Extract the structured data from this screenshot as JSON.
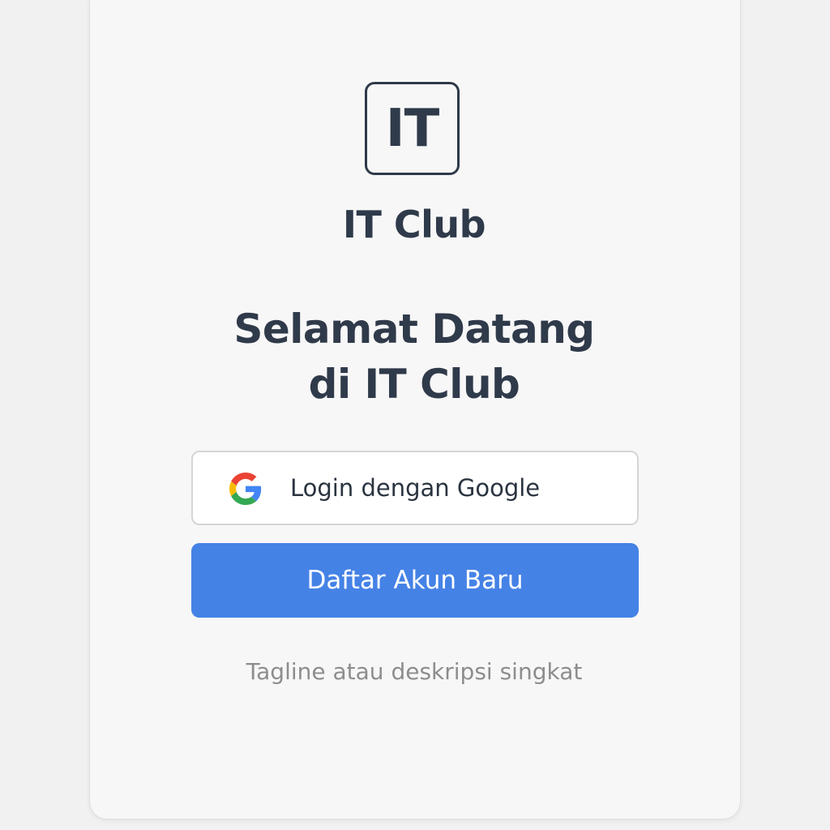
{
  "logo": {
    "text": "IT"
  },
  "app_name": "IT Club",
  "welcome": {
    "line1": "Selamat Datang",
    "line2": "di IT Club"
  },
  "buttons": {
    "google_login": {
      "label": "Login dengan Google",
      "icon": "google-icon"
    },
    "register": {
      "label": "Daftar Akun Baru"
    }
  },
  "tagline": "Tagline atau deskripsi singkat",
  "colors": {
    "primary": "#4582e6",
    "text_dark": "#2f3a4a",
    "muted": "#8d8d8d",
    "background": "#f1f1f1",
    "card": "#f7f7f7"
  }
}
